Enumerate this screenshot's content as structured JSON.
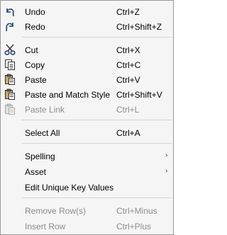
{
  "menu": {
    "undo": {
      "label": "Undo",
      "shortcut": "Ctrl+Z",
      "icon": "undo-icon"
    },
    "redo": {
      "label": "Redo",
      "shortcut": "Ctrl+Shift+Z",
      "icon": "redo-icon"
    },
    "cut": {
      "label": "Cut",
      "shortcut": "Ctrl+X",
      "icon": "scissors-icon"
    },
    "copy": {
      "label": "Copy",
      "shortcut": "Ctrl+C",
      "icon": "copy-icon"
    },
    "paste": {
      "label": "Paste",
      "shortcut": "Ctrl+V",
      "icon": "clipboard-icon"
    },
    "paste_match": {
      "label": "Paste and Match Style",
      "shortcut": "Ctrl+Shift+V",
      "icon": "clipboard-icon"
    },
    "paste_link": {
      "label": "Paste Link",
      "shortcut": "Ctrl+L",
      "icon": "paste-link-icon",
      "disabled": true
    },
    "select_all": {
      "label": "Select All",
      "shortcut": "Ctrl+A"
    },
    "spelling": {
      "label": "Spelling",
      "submenu": true
    },
    "asset": {
      "label": "Asset",
      "submenu": true
    },
    "edit_unique": {
      "label": "Edit Unique Key Values"
    },
    "remove_rows": {
      "label": "Remove Row(s)",
      "shortcut": "Ctrl+Minus",
      "disabled": true
    },
    "insert_row": {
      "label": "Insert Row",
      "shortcut": "Ctrl+Plus",
      "disabled": true
    },
    "submenu_arrow": "›"
  },
  "colors": {
    "menu_bg": "#f5f5f5",
    "border": "#9a9a9a",
    "separator": "#d4d4d4",
    "disabled_text": "#8c8c8c",
    "icon_blue": "#2f5f9e"
  }
}
